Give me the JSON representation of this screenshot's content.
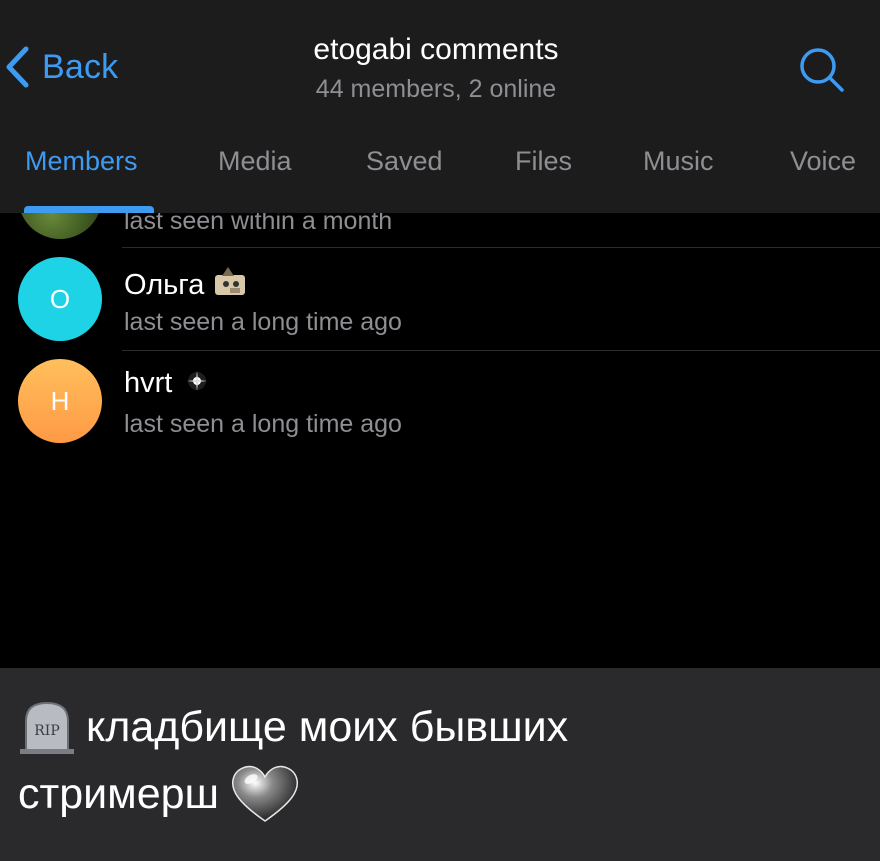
{
  "header": {
    "back_label": "Back",
    "title": "etogabi comments",
    "subtitle": "44 members, 2 online",
    "accent_color": "#3e9bf2"
  },
  "tabs": [
    {
      "label": "Members",
      "active": true
    },
    {
      "label": "Media",
      "active": false
    },
    {
      "label": "Saved",
      "active": false
    },
    {
      "label": "Files",
      "active": false
    },
    {
      "label": "Music",
      "active": false
    },
    {
      "label": "Voice",
      "active": false
    }
  ],
  "members": [
    {
      "name": "",
      "status": "last seen within a month",
      "avatar_letter": "",
      "avatar_type": "photo"
    },
    {
      "name": "Ольга",
      "status": "last seen a long time ago",
      "avatar_letter": "О",
      "avatar_color": "#1fd3e6",
      "badge_icon": "cat-sticker-icon"
    },
    {
      "name": "hvrt",
      "status": "last seen a long time ago",
      "avatar_letter": "Н",
      "avatar_color": "#ffa94d",
      "badge_icon": "sparkle-icon"
    }
  ],
  "caption": {
    "line1": "кладбище моих бывших",
    "line2": "стримерш",
    "leading_icon": "tombstone-icon",
    "trailing_icon": "heart-icon",
    "tombstone_text": "RIP"
  }
}
